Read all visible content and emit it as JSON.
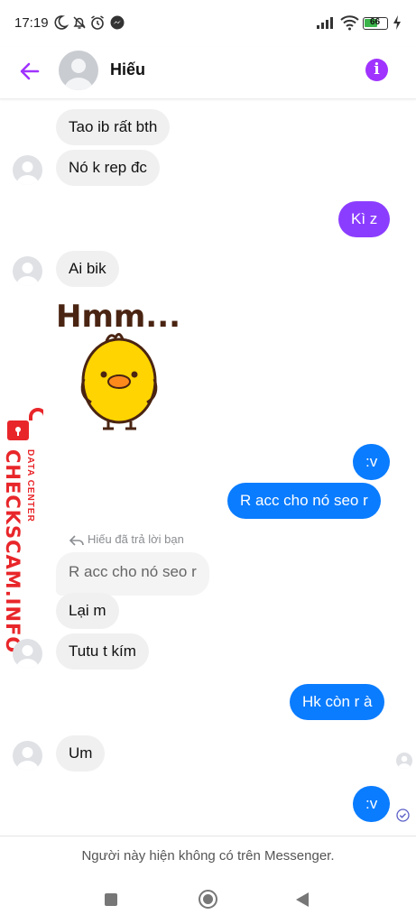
{
  "status_bar": {
    "time": "17:19",
    "battery": "66"
  },
  "header": {
    "contact_name": "Hiếu"
  },
  "messages": [
    {
      "side": "in",
      "text": "Tao ib rất bth"
    },
    {
      "side": "in",
      "text": "Nó k rep đc"
    },
    {
      "side": "out",
      "text": "Kì z",
      "color": "#8b3dff"
    },
    {
      "side": "in",
      "text": "Ai bik"
    },
    {
      "side": "in",
      "sticker": "Hmm..."
    },
    {
      "side": "out",
      "text": ":v"
    },
    {
      "side": "out",
      "text": "R acc cho nó seo r"
    },
    {
      "side": "in",
      "text": "R acc cho nó seo r",
      "quoted": true
    },
    {
      "side": "in",
      "text": "Lại m"
    },
    {
      "side": "in",
      "text": "Tutu t kím"
    },
    {
      "side": "out",
      "text": "Hk còn r à"
    },
    {
      "side": "in",
      "text": "Um"
    },
    {
      "side": "out",
      "text": ":v"
    }
  ],
  "reply_note": "Hiếu đã trả lời bạn",
  "watermark": {
    "main": "CHECKSCAM.INFO",
    "sub": "DATA CENTER"
  },
  "footer": {
    "notice": "Người này hiện không có trên Messenger."
  },
  "colors": {
    "accent": "#a033ff",
    "outgoing": "#0a7cff",
    "incoming": "#f0f0f0",
    "watermark": "#e8262a"
  }
}
